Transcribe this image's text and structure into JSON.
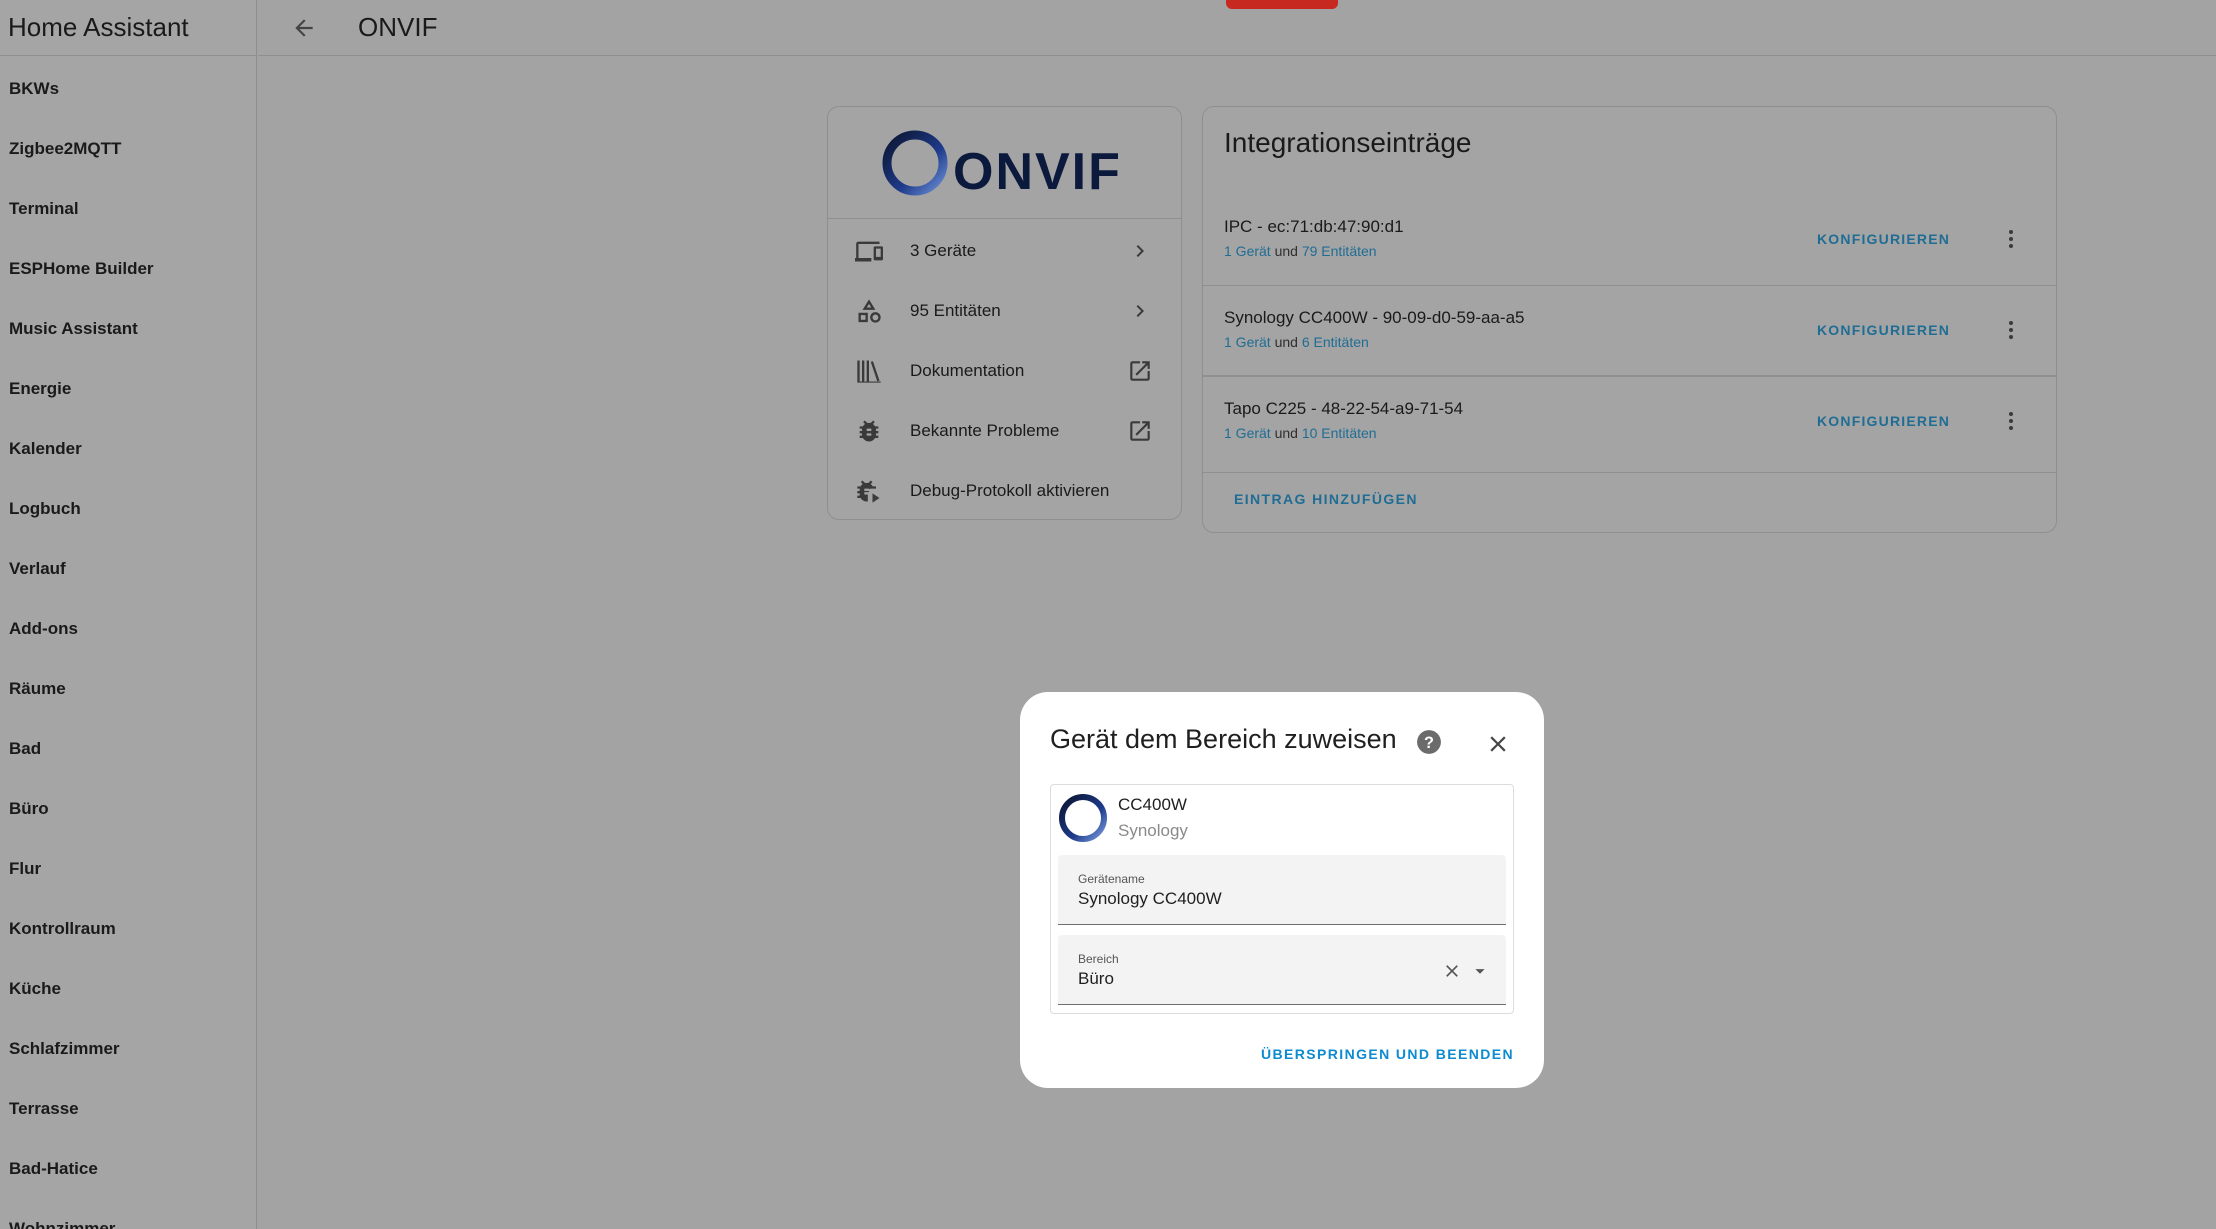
{
  "sidebar": {
    "title": "Home Assistant",
    "items": [
      {
        "label": "BKWs"
      },
      {
        "label": "Zigbee2MQTT"
      },
      {
        "label": "Terminal"
      },
      {
        "label": "ESPHome Builder"
      },
      {
        "label": "Music Assistant"
      },
      {
        "label": "Energie"
      },
      {
        "label": "Kalender"
      },
      {
        "label": "Logbuch"
      },
      {
        "label": "Verlauf"
      },
      {
        "label": "Add-ons"
      },
      {
        "label": "Räume"
      },
      {
        "label": "Bad"
      },
      {
        "label": "Büro"
      },
      {
        "label": "Flur"
      },
      {
        "label": "Kontrollraum"
      },
      {
        "label": "Küche"
      },
      {
        "label": "Schlafzimmer"
      },
      {
        "label": "Terrasse"
      },
      {
        "label": "Bad-Hatice"
      },
      {
        "label": "Wohnzimmer"
      }
    ]
  },
  "header": {
    "title": "ONVIF",
    "back_icon": "arrow-left-icon"
  },
  "info_card": {
    "logo_text": "ONVIF",
    "rows": [
      {
        "icon": "devices-icon",
        "label": "3 Geräte",
        "trail": "chevron-right-icon"
      },
      {
        "icon": "shapes-icon",
        "label": "95 Entitäten",
        "trail": "chevron-right-icon"
      },
      {
        "icon": "book-icon",
        "label": "Dokumentation",
        "trail": "open-in-new-icon"
      },
      {
        "icon": "bug-icon",
        "label": "Bekannte Probleme",
        "trail": "open-in-new-icon"
      },
      {
        "icon": "bug-play-icon",
        "label": "Debug-Protokoll aktivieren",
        "trail": ""
      }
    ]
  },
  "entries_card": {
    "title": "Integrationseinträge",
    "entries": [
      {
        "name": "IPC - ec:71:db:47:90:d1",
        "devices": "1 Gerät",
        "and": "und",
        "entities": "79 Entitäten",
        "configure": "KONFIGURIEREN"
      },
      {
        "name": "Synology CC400W - 90-09-d0-59-aa-a5",
        "devices": "1 Gerät",
        "and": "und",
        "entities": "6 Entitäten",
        "configure": "KONFIGURIEREN"
      },
      {
        "name": "Tapo C225 - 48-22-54-a9-71-54",
        "devices": "1 Gerät",
        "and": "und",
        "entities": "10 Entitäten",
        "configure": "KONFIGURIEREN"
      }
    ],
    "add_entry": "EINTRAG HINZUFÜGEN"
  },
  "dialog": {
    "title": "Gerät dem Bereich zuweisen",
    "device_model": "CC400W",
    "device_manufacturer": "Synology",
    "name_field": {
      "label": "Gerätename",
      "value": "Synology CC400W"
    },
    "area_field": {
      "label": "Bereich",
      "value": "Büro"
    },
    "skip_button": "ÜBERSPRINGEN UND BEENDEN"
  },
  "colors": {
    "link": "#1f6d94",
    "dialog_accent": "#0d8bd1",
    "overlay_bg": "#a3a3a3",
    "onvif_blue": "#1e2a5c"
  }
}
